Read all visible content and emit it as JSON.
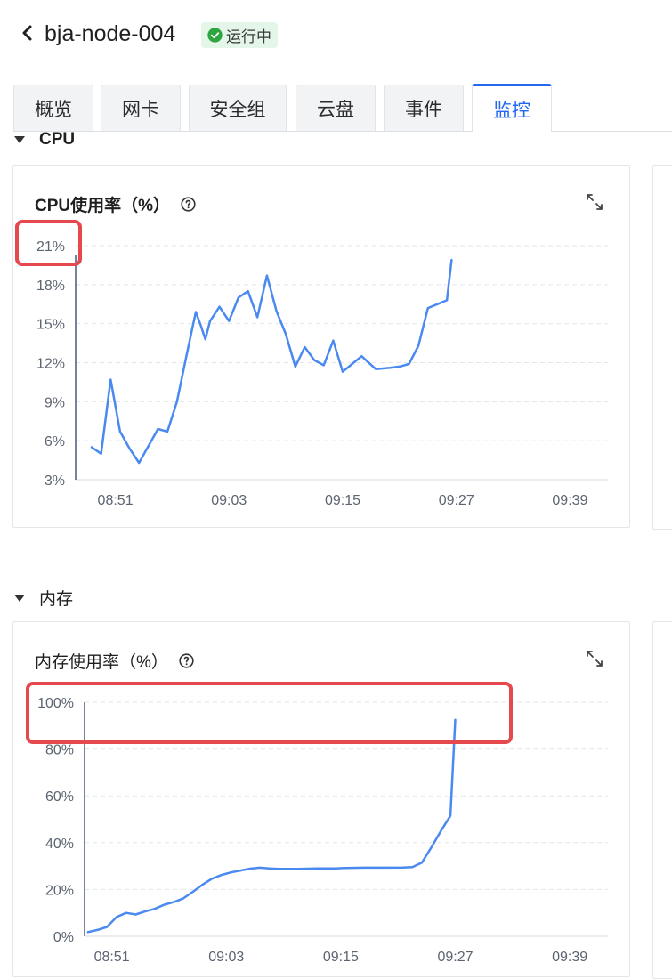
{
  "header": {
    "title": "bja-node-004",
    "status": "运行中",
    "status_color": "#2da641"
  },
  "tabs": [
    {
      "label": "概览",
      "active": false
    },
    {
      "label": "网卡",
      "active": false
    },
    {
      "label": "安全组",
      "active": false
    },
    {
      "label": "云盘",
      "active": false
    },
    {
      "label": "事件",
      "active": false
    },
    {
      "label": "监控",
      "active": true
    }
  ],
  "sections": {
    "cpu": {
      "label": "CPU"
    },
    "memory": {
      "label": "内存"
    }
  },
  "colors": {
    "accent": "#2468f2",
    "line": "#4a8af0",
    "highlight": "#e5484d"
  },
  "chart_data": [
    {
      "type": "line",
      "title": "CPU使用率（%）",
      "x_ticks": [
        "08:51",
        "09:03",
        "09:15",
        "09:27",
        "09:39"
      ],
      "y_ticks": [
        "3%",
        "6%",
        "9%",
        "12%",
        "15%",
        "18%",
        "21%"
      ],
      "ylim": [
        3,
        21
      ],
      "xlim": [
        "08:47",
        "09:43"
      ],
      "grid": true,
      "series": [
        {
          "x": [
            "08:48:30",
            "08:49:30",
            "08:50:30",
            "08:51:30",
            "08:52:30",
            "08:53:30",
            "08:55:30",
            "08:56:30",
            "08:57:30",
            "08:58:30",
            "08:59:30",
            "09:00:00",
            "09:00:30",
            "09:01:00",
            "09:02:00",
            "09:03:00",
            "09:04:00",
            "09:05:00",
            "09:06:00",
            "09:07:00",
            "09:08:00",
            "09:09:00",
            "09:10:00",
            "09:11:00",
            "09:12:00",
            "09:13:00",
            "09:14:00",
            "09:15:00",
            "09:16:00",
            "09:17:00",
            "09:18:30",
            "09:20:00",
            "09:21:00",
            "09:22:00",
            "09:23:00",
            "09:24:00",
            "09:25:00",
            "09:26:00",
            "09:26:30"
          ],
          "y": [
            5.5,
            5.0,
            10.7,
            6.7,
            5.4,
            4.3,
            6.9,
            6.7,
            9.0,
            12.5,
            15.9,
            14.9,
            13.8,
            15.2,
            16.3,
            15.2,
            17.0,
            17.5,
            15.5,
            18.7,
            16.0,
            14.2,
            11.7,
            13.2,
            12.2,
            11.8,
            13.7,
            11.3,
            11.9,
            12.5,
            11.5,
            11.6,
            11.7,
            11.9,
            13.3,
            16.2,
            16.5,
            16.8,
            19.9
          ]
        }
      ]
    },
    {
      "type": "line",
      "title": "内存使用率（%）",
      "x_ticks": [
        "08:51",
        "09:03",
        "09:15",
        "09:27",
        "09:39"
      ],
      "y_ticks": [
        "0%",
        "20%",
        "40%",
        "60%",
        "80%",
        "100%"
      ],
      "ylim": [
        0,
        100
      ],
      "xlim": [
        "08:46",
        "09:43"
      ],
      "grid": true,
      "series": [
        {
          "x": [
            "08:48:30",
            "08:49:30",
            "08:50:30",
            "08:51:30",
            "08:52:30",
            "08:53:30",
            "08:54:30",
            "08:55:30",
            "08:56:30",
            "08:57:30",
            "08:58:30",
            "08:59:30",
            "09:00:30",
            "09:01:30",
            "09:02:30",
            "09:03:30",
            "09:04:30",
            "09:05:30",
            "09:06:30",
            "09:07:30",
            "09:08:30",
            "09:10:30",
            "09:12:30",
            "09:14:30",
            "09:15:30",
            "09:17:30",
            "09:19:30",
            "09:21:30",
            "09:22:30",
            "09:23:30",
            "09:24:30",
            "09:25:30",
            "09:26:30",
            "09:27:00"
          ],
          "y": [
            1.8,
            2.7,
            4.0,
            8.2,
            10.0,
            9.3,
            10.6,
            11.7,
            13.5,
            14.6,
            16.2,
            19.0,
            22.0,
            24.6,
            26.2,
            27.3,
            28.1,
            28.9,
            29.3,
            29.0,
            28.8,
            28.8,
            29.0,
            29.0,
            29.2,
            29.3,
            29.3,
            29.4,
            29.6,
            31.5,
            38.0,
            45.0,
            51.5,
            92.5
          ]
        }
      ]
    }
  ]
}
